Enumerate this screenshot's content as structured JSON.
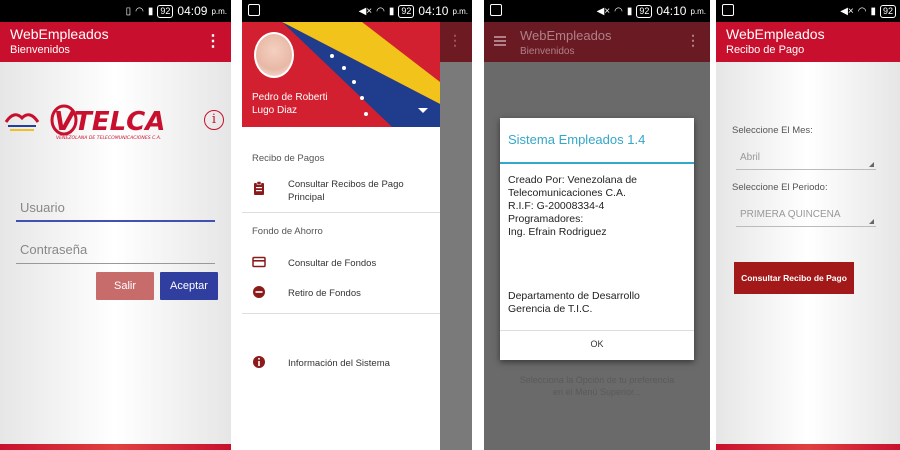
{
  "status_bars": [
    {
      "battery": "92",
      "time": "04:09",
      "ampm": "p.m."
    },
    {
      "battery": "92",
      "time": "04:10",
      "ampm": "p.m."
    },
    {
      "battery": "92",
      "time": "04:10",
      "ampm": "p.m."
    },
    {
      "battery": "92",
      "time": "",
      "ampm": ""
    }
  ],
  "screen1": {
    "app_title": "WebEmpleados",
    "app_subtitle": "Bienvenidos",
    "logo_text": "VTELCA",
    "logo_tagline": "VENEZOLANA DE TELECOMUNICACIONES C.A.",
    "info_icon_glyph": "i",
    "username_placeholder": "Usuario",
    "password_placeholder": "Contraseña",
    "salir_label": "Salir",
    "aceptar_label": "Aceptar",
    "colors": {
      "primary": "#c8102e",
      "aceptar": "#303f9f",
      "salir": "#c86b6b"
    }
  },
  "screen2": {
    "profile_name_line1": "Pedro de Roberti",
    "profile_name_line2": "Lugo Diaz",
    "sections": [
      {
        "label": "Recibo de Pagos"
      },
      {
        "label": "Fondo de Ahorro"
      }
    ],
    "items": [
      {
        "label_line1": "Consultar Recibos de Pago",
        "label_line2": "Principal",
        "icon": "clipboard-icon"
      },
      {
        "label_line1": "Consultar de Fondos",
        "label_line2": "",
        "icon": "card-icon"
      },
      {
        "label_line1": "Retiro de Fondos",
        "label_line2": "",
        "icon": "minus-circle-icon"
      },
      {
        "label_line1": "Información del Sistema",
        "label_line2": "",
        "icon": "info-icon"
      }
    ]
  },
  "screen3": {
    "app_title": "WebEmpleados",
    "app_subtitle": "Bienvenidos",
    "dialog_title": "Sistema Empleados 1.4",
    "body_lines": [
      "Creado Por: Venezolana de",
      "Telecomunicaciones C.A.",
      "R.I.F: G-20008334-4",
      "Programadores:",
      "Ing. Efrain Rodriguez"
    ],
    "footer_lines": [
      "Departamento de Desarrollo",
      "Gerencia de T.I.C."
    ],
    "ok_label": "OK",
    "background_hint_line1": "Selecciona la Opción de tu preferencia",
    "background_hint_line2": "en el Menú Superior..."
  },
  "screen4": {
    "app_title": "WebEmpleados",
    "app_subtitle": "Recibo de Pago",
    "mes_label": "Seleccione El Mes:",
    "mes_value": "Abril",
    "periodo_label": "Seleccione El Periodo:",
    "periodo_value": "PRIMERA QUINCENA",
    "consultar_label": "Consultar Recibo de Pago"
  }
}
